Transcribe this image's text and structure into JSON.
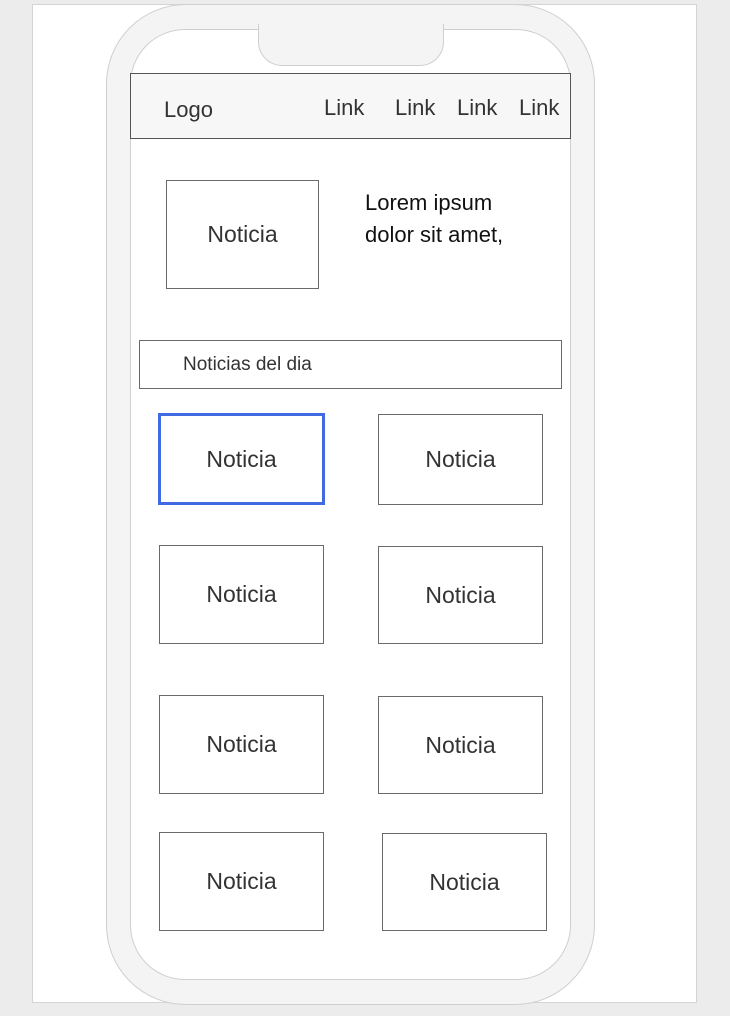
{
  "navbar": {
    "logo": "Logo",
    "links": [
      "Link",
      "Link",
      "Link",
      "Link"
    ]
  },
  "featured": {
    "image_label": "Noticia",
    "text": "Lorem ipsum dolor sit amet,"
  },
  "section": {
    "title": "Noticias del dia"
  },
  "news_grid": {
    "items": [
      {
        "label": "Noticia",
        "selected": true
      },
      {
        "label": "Noticia"
      },
      {
        "label": "Noticia"
      },
      {
        "label": "Noticia"
      },
      {
        "label": "Noticia"
      },
      {
        "label": "Noticia"
      },
      {
        "label": "Noticia"
      },
      {
        "label": "Noticia"
      }
    ]
  },
  "colors": {
    "selection": "#4169e1"
  }
}
